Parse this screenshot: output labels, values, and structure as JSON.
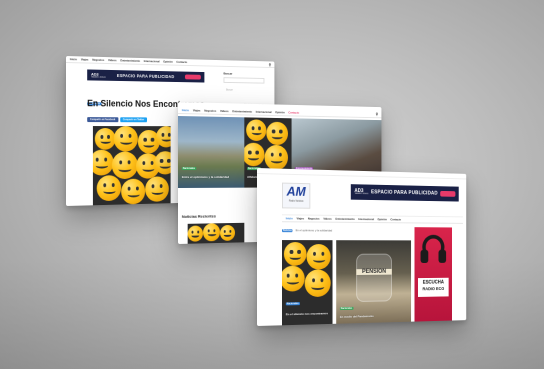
{
  "back_screen": {
    "nav": [
      "Inicio",
      "Viajes",
      "Negocios",
      "Videos",
      "Entretenimiento",
      "Internacional",
      "Opinión",
      "Contacto"
    ],
    "ad": {
      "title": "AD3",
      "subtitle": "TAMAÑO 468x60",
      "text": "ESPACIO PARA PUBLICIDAD"
    },
    "category_badge": "Nacionales",
    "headline": "En Silencio Nos Encontramos",
    "buttons": [
      "Compartir en Facebook",
      "Compartir en Twitter"
    ],
    "sidebar_search_label": "Buscar",
    "sidebar_search_placeholder": "Buscar",
    "sidebar_heading": "Noticias recientes"
  },
  "mid_screen": {
    "nav": [
      "Inicio",
      "Viajes",
      "Negocios",
      "Videos",
      "Entretenimiento",
      "Internacional",
      "Opinión",
      "Contacto"
    ],
    "tiles": [
      {
        "badge": "Nacionales",
        "caption": "Entre el optimismo y la solidaridad"
      },
      {
        "badge": "Nacionales",
        "caption": "Alfabeta educativo de Bagdag"
      },
      {
        "badge": "Entretenimiento",
        "caption": "La Actividad en la vida sus escenas como personas más pensantes"
      }
    ],
    "section_title": "Noticias Recientes"
  },
  "front_screen": {
    "logo_text": "AM",
    "logo_sub": "Radio Noticias",
    "ad": {
      "title": "AD3",
      "subtitle": "TAMAÑO 468x60",
      "text": "ESPACIO PARA PUBLICIDAD"
    },
    "nav": [
      "Inicio",
      "Viajes",
      "Negocios",
      "Videos",
      "Entretenimiento",
      "Internacional",
      "Opinión",
      "Contacto"
    ],
    "ticker_label": "Noticias",
    "ticker_text": "En el optimismo y la solidaridad",
    "tiles": [
      {
        "badge": "Nacionales",
        "caption": "En el silencio nos encontramos"
      },
      {
        "badge": "Nacionales",
        "caption": "En medio del Pandemonio"
      }
    ],
    "jar_label": "PENSION",
    "radio_promo": {
      "line1": "ESCUCHA",
      "line2": "RADIO ECO"
    }
  }
}
